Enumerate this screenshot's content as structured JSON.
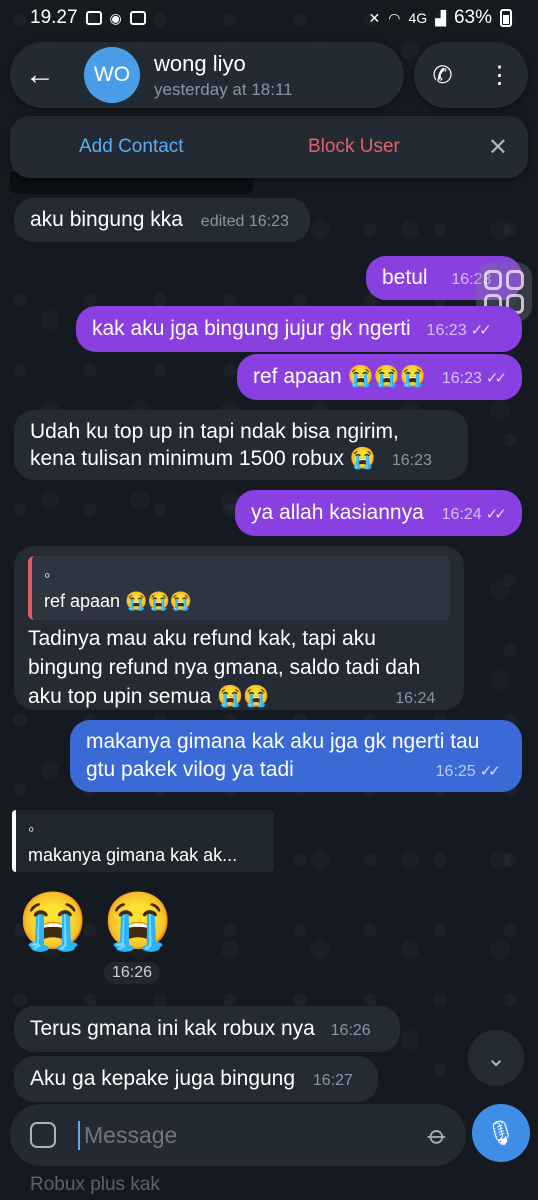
{
  "status_bar": {
    "time": "19.27",
    "battery": "63%",
    "network": "4G"
  },
  "header": {
    "avatar_initials": "WO",
    "name": "wong liyo",
    "status": "yesterday at 18:11"
  },
  "banner": {
    "add_contact": "Add Contact",
    "block_user": "Block User"
  },
  "messages": [
    {
      "dir": "in",
      "text": "aku bingung kka",
      "meta": "edited 16:23"
    },
    {
      "dir": "out",
      "text": "betul",
      "time": "16:23"
    },
    {
      "dir": "out",
      "text": "kak aku jga bingung jujur gk ngerti",
      "time": "16:23"
    },
    {
      "dir": "out",
      "text": "ref apaan 😭😭😭",
      "time": "16:23"
    },
    {
      "dir": "in",
      "text_line1": "Udah ku top up in tapi ndak bisa ngirim,",
      "text_line2": "kena tulisan minimum 1500 robux 😭",
      "time": "16:23"
    },
    {
      "dir": "out",
      "text": "ya allah kasiannya",
      "time": "16:24"
    },
    {
      "dir": "in",
      "reply_name": "◦",
      "reply_text": "ref apaan 😭😭😭",
      "text_line1": "Tadinya mau aku refund kak, tapi aku",
      "text_line2": "bingung refund nya gmana, saldo tadi dah",
      "text_line3": "aku top upin semua 😭😭",
      "time": "16:24"
    },
    {
      "dir": "out",
      "text_line1": "makanya gimana kak aku jga gk ngerti tau",
      "text_line2": "gtu pakek vilog ya tadi",
      "time": "16:25"
    },
    {
      "dir": "in",
      "reply_name": "◦",
      "reply_text": "makanya gimana kak ak...",
      "emoji": "😭 😭",
      "time": "16:26"
    },
    {
      "dir": "in",
      "text": "Terus gmana ini kak robux nya",
      "time": "16:26"
    },
    {
      "dir": "in",
      "text": "Aku ga kepake juga bingung",
      "time": "16:27"
    }
  ],
  "composer": {
    "placeholder": "Message",
    "below_text": "Robux plus kak"
  }
}
